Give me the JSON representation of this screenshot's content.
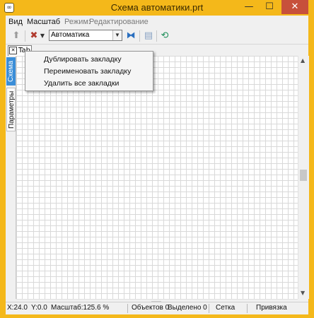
{
  "window": {
    "title": "Схема автоматики.prt",
    "app_icon_glyph": "∞",
    "controls": {
      "minimize": "—",
      "maximize": "☐",
      "close": "✕"
    }
  },
  "menubar": {
    "items": [
      "Вид",
      "Масштаб"
    ],
    "mode_label": "Режим:",
    "mode_value": "Редактирование"
  },
  "toolbar": {
    "up_icon": "arrow-up-icon",
    "tools_icon": "tools-icon",
    "combo_value": "Автоматика",
    "icons": [
      "arrow-up-icon",
      "tools-icon",
      "dropdown-arrow-icon",
      "scheme-select-icon",
      "layers-icon",
      "sync-icon"
    ]
  },
  "tabs": {
    "items": [
      {
        "label": "Tab 1"
      }
    ]
  },
  "side_panel": {
    "tabs": [
      "Схема",
      "Параметры"
    ]
  },
  "context_menu": {
    "items": [
      "Дублировать закладку",
      "Переименовать закладку",
      "Удалить все закладки"
    ]
  },
  "statusbar": {
    "x": "X:24.0",
    "y": "Y:0.0",
    "scale": "Масштаб:125.6 %",
    "objects": "Объектов 0",
    "selected": "Выделено 0",
    "grid": "Сетка",
    "snap": "Привязка"
  },
  "colors": {
    "title_bar": "#f4b81a",
    "close_button": "#c7503b",
    "active_side_tab": "#3b8ed8",
    "grid_line": "#d9d9d9"
  }
}
